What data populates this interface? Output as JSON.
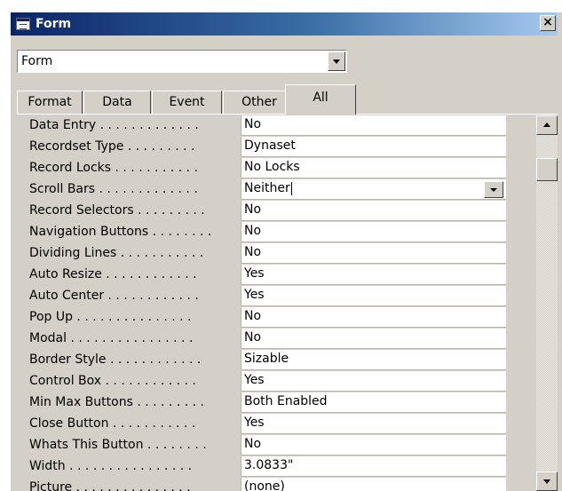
{
  "window": {
    "title": "Form",
    "icon": "form-properties-icon",
    "close_label": "×"
  },
  "selector": {
    "value": "Form"
  },
  "tabs": [
    {
      "label": "Format",
      "active": false
    },
    {
      "label": "Data",
      "active": false
    },
    {
      "label": "Event",
      "active": false
    },
    {
      "label": "Other",
      "active": false
    },
    {
      "label": "All",
      "active": true
    }
  ],
  "properties": [
    {
      "label": "Data Entry . . . . . . . . . . . . .",
      "value": "No"
    },
    {
      "label": "Recordset Type . . . . . . . . .",
      "value": "Dynaset"
    },
    {
      "label": "Record Locks . . . . . . . . . . .",
      "value": "No Locks"
    },
    {
      "label": "Scroll Bars . . . . . . . . . . . . .",
      "value": "Neither",
      "focused": true
    },
    {
      "label": "Record Selectors . . . . . . . . .",
      "value": "No"
    },
    {
      "label": "Navigation Buttons . . . . . . . .",
      "value": "No"
    },
    {
      "label": "Dividing Lines . . . . . . . . . . .",
      "value": "No"
    },
    {
      "label": "Auto Resize . . . . . . . . . . . .",
      "value": "Yes"
    },
    {
      "label": "Auto Center . . . . . . . . . . . .",
      "value": "Yes"
    },
    {
      "label": "Pop Up . . . . . . . . . . . . . . .",
      "value": "No"
    },
    {
      "label": "Modal . . . . . . . . . . . . . . . .",
      "value": "No"
    },
    {
      "label": "Border Style . . . . . . . . . . . .",
      "value": "Sizable"
    },
    {
      "label": "Control Box . . . . . . . . . . . .",
      "value": "Yes"
    },
    {
      "label": "Min Max Buttons . . . . . . . . .",
      "value": "Both Enabled"
    },
    {
      "label": "Close Button . . . . . . . . . . .",
      "value": "Yes"
    },
    {
      "label": "Whats This Button . . . . . . . .",
      "value": "No"
    },
    {
      "label": "Width . . . . . . . . . . . . . . . .",
      "value": "3.0833\""
    },
    {
      "label": "Picture . . . . . . . . . . . . . . .",
      "value": "(none)"
    }
  ],
  "colors": {
    "titlebar_start": "#0a246a",
    "titlebar_end": "#a6caf0",
    "face": "#d4d0c8"
  }
}
